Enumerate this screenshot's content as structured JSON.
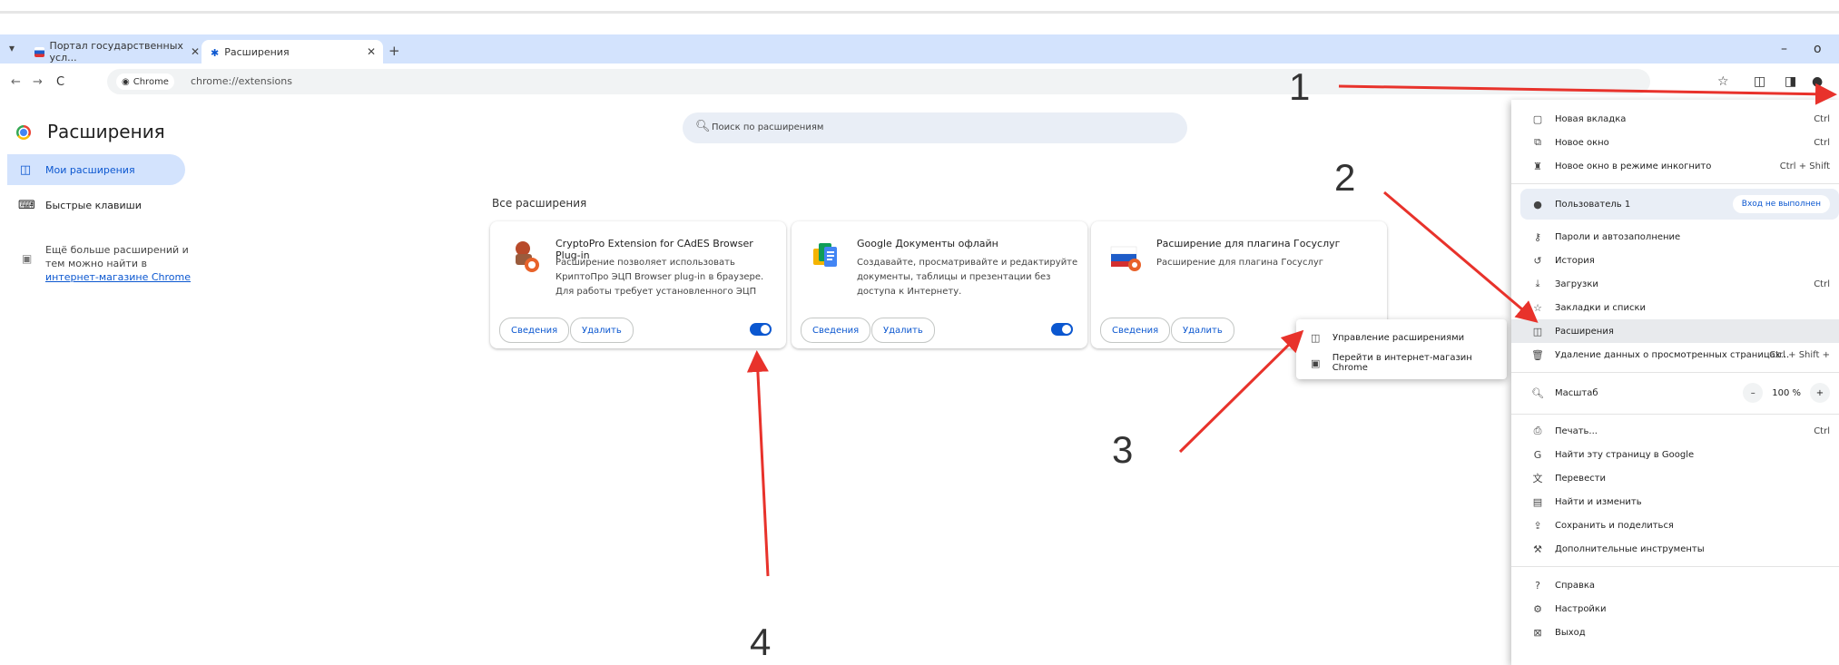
{
  "browser": {
    "tabs": [
      {
        "title": "Портал государственных усл...",
        "active": false
      },
      {
        "title": "Расширения",
        "active": true
      }
    ],
    "new_tab": "+",
    "window_controls": {
      "minimize": "–",
      "maximize": "o"
    },
    "address": {
      "chip": "Chrome",
      "url": "chrome://extensions"
    }
  },
  "page": {
    "title": "Расширения",
    "search_placeholder": "Поиск по расширениям",
    "sidebar": {
      "items": [
        {
          "label": "Мои расширения",
          "active": true
        },
        {
          "label": "Быстрые клавиши",
          "active": false
        }
      ],
      "note_text": "Ещё больше расширений и тем можно найти в ",
      "note_link": "интернет-магазине Chrome"
    },
    "section_title": "Все расширения",
    "extensions": [
      {
        "name": "CryptoPro Extension for CAdES Browser Plug-in",
        "description": "Расширение позволяет использовать КриптоПро ЭЦП Browser plug-in в браузере. Для работы требует установленного ЭЦП",
        "details": "Сведения",
        "remove": "Удалить",
        "enabled": true,
        "show_toggle": true
      },
      {
        "name": "Google Документы офлайн",
        "description": "Создавайте, просматривайте и редактируйте документы, таблицы и презентации без доступа к Интернету.",
        "details": "Сведения",
        "remove": "Удалить",
        "enabled": true,
        "show_toggle": true
      },
      {
        "name": "Расширение для плагина Госуслуг",
        "description": "Расширение для плагина Госуслуг",
        "details": "Сведения",
        "remove": "Удалить",
        "enabled": true,
        "show_toggle": false
      }
    ]
  },
  "context_menu": {
    "items": [
      {
        "label": "Управление расширениями",
        "icon": "puzzle-icon"
      },
      {
        "label": "Перейти в интернет-магазин Chrome",
        "icon": "store-icon"
      }
    ]
  },
  "chrome_menu": {
    "new_tab": {
      "label": "Новая вкладка",
      "shortcut": "Ctrl"
    },
    "new_window": {
      "label": "Новое окно",
      "shortcut": "Ctrl"
    },
    "incognito": {
      "label": "Новое окно в режиме инкогнито",
      "shortcut": "Ctrl + Shift"
    },
    "profile": {
      "label": "Пользователь 1",
      "signin": "Вход не выполнен"
    },
    "passwords": {
      "label": "Пароли и автозаполнение"
    },
    "history": {
      "label": "История"
    },
    "downloads": {
      "label": "Загрузки",
      "shortcut": "Ctrl"
    },
    "bookmarks": {
      "label": "Закладки и списки"
    },
    "extensions": {
      "label": "Расширения"
    },
    "clear": {
      "label": "Удаление данных о просмотренных страницах...",
      "shortcut": "Ctrl + Shift +"
    },
    "zoom": {
      "label": "Масштаб",
      "minus": "–",
      "value": "100 %",
      "plus": "+"
    },
    "print": {
      "label": "Печать...",
      "shortcut": "Ctrl"
    },
    "google": {
      "label": "Найти эту страницу в Google"
    },
    "translate": {
      "label": "Перевести"
    },
    "find": {
      "label": "Найти и изменить"
    },
    "share": {
      "label": "Сохранить и поделиться"
    },
    "tools": {
      "label": "Дополнительные инструменты"
    },
    "help": {
      "label": "Справка"
    },
    "settings": {
      "label": "Настройки"
    },
    "exit": {
      "label": "Выход"
    }
  },
  "annotations": {
    "n1": "1",
    "n2": "2",
    "n3": "3",
    "n4": "4",
    "arrow_color": "#e8322b"
  }
}
